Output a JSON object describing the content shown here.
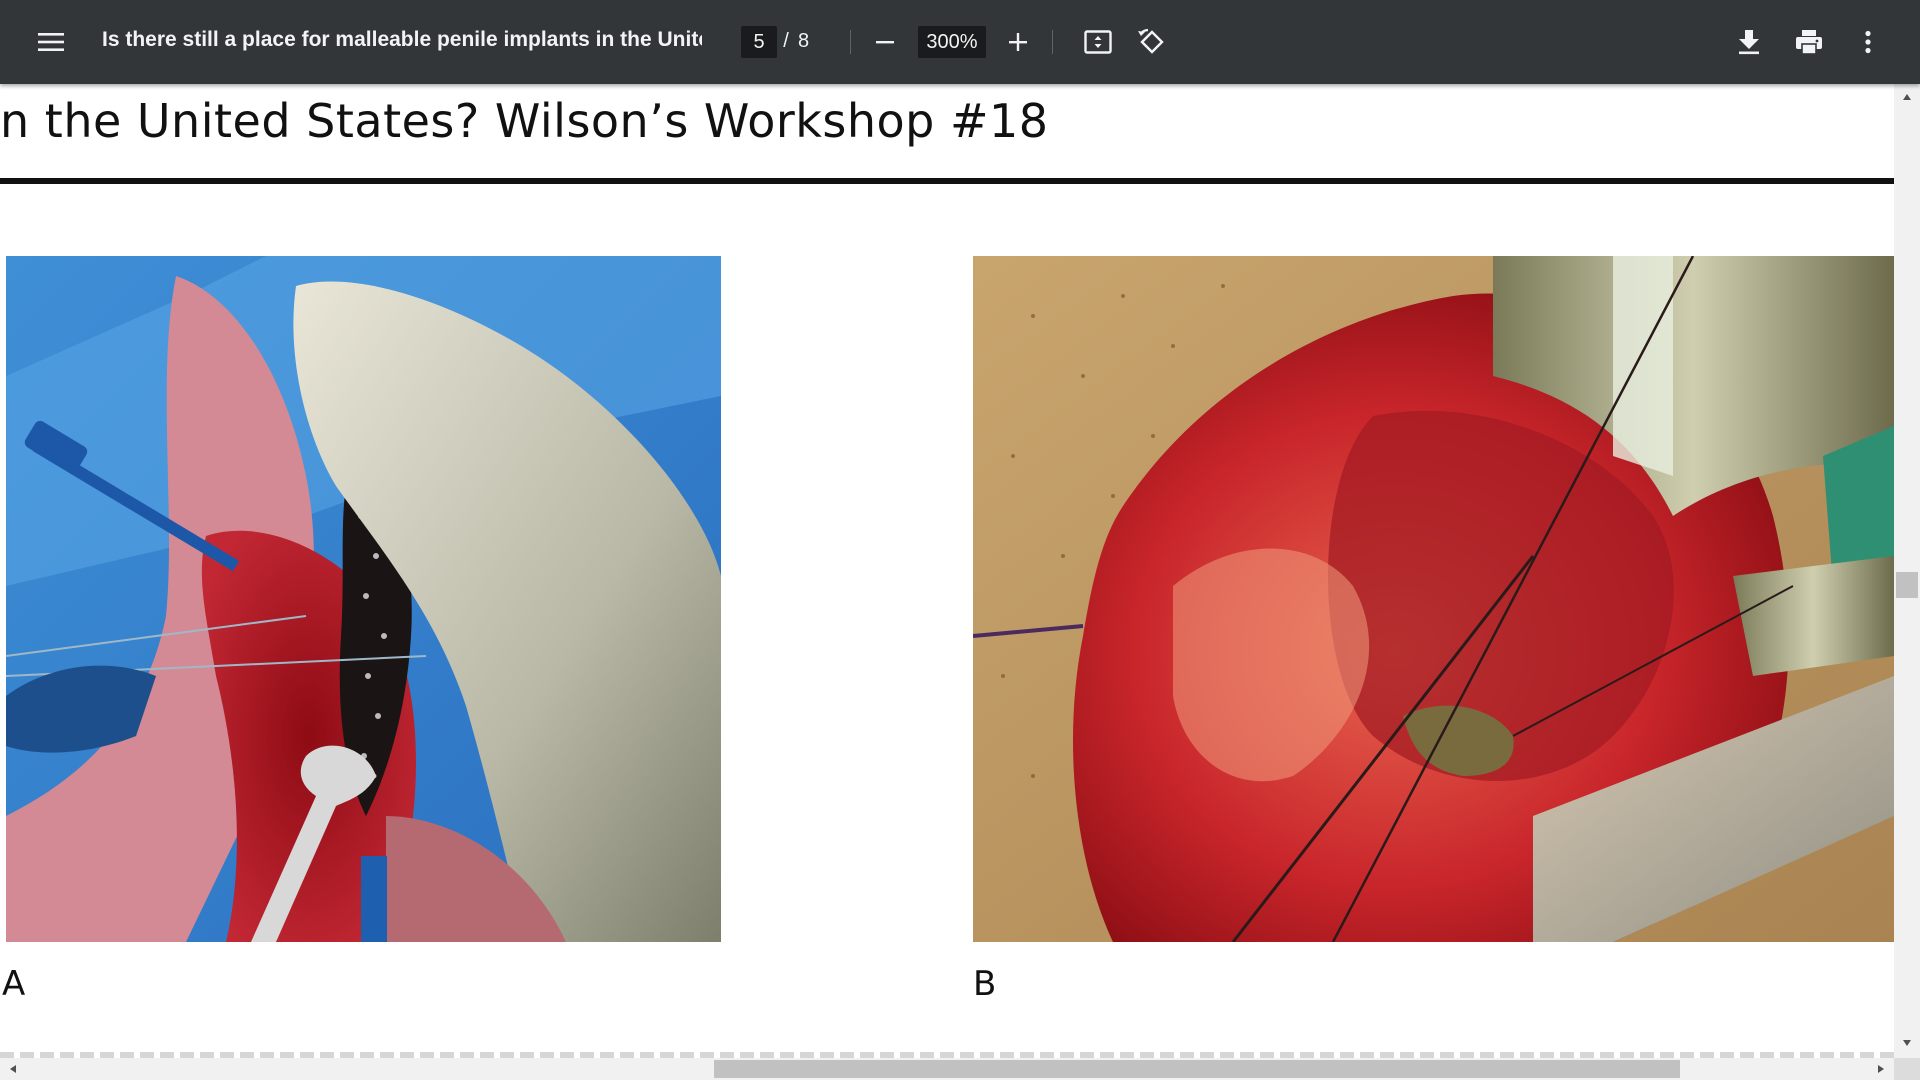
{
  "toolbar": {
    "title": "Is there still a place for malleable penile implants in the United ...",
    "menu_icon": "hamburger-menu-icon",
    "current_page": "5",
    "page_separator": "/",
    "total_pages": "8",
    "zoom_out_icon": "minus-icon",
    "zoom_level": "300%",
    "zoom_in_icon": "plus-icon",
    "fit_page_icon": "fit-to-page-icon",
    "rotate_icon": "rotate-counterclockwise-icon",
    "download_icon": "download-icon",
    "print_icon": "print-icon",
    "more_icon": "more-vert-icon"
  },
  "document": {
    "heading": "n the United States? Wilson’s Workshop #18",
    "figure_a_label": "A",
    "figure_b_label": "B"
  },
  "colors": {
    "toolbar_bg": "#323639",
    "toolbar_text": "#f1f3f4",
    "page_bg": "#ffffff"
  }
}
